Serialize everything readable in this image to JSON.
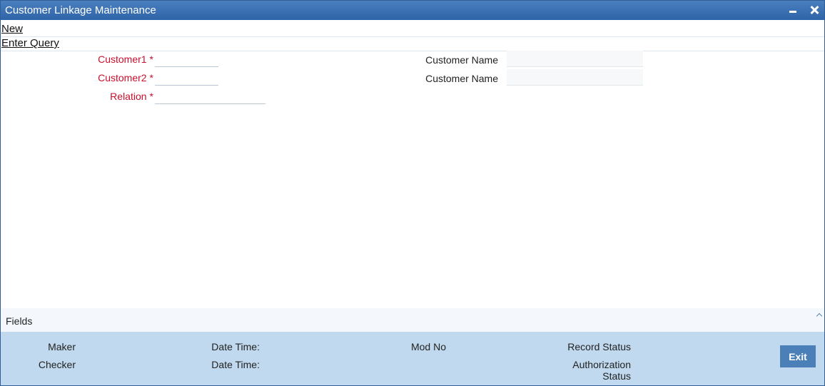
{
  "window": {
    "title": "Customer Linkage Maintenance"
  },
  "menu": {
    "new": "New",
    "enter_query": "Enter Query"
  },
  "form": {
    "customer1": {
      "label": "Customer1",
      "required_mark": "*",
      "value": ""
    },
    "customer2": {
      "label": "Customer2",
      "required_mark": "*",
      "value": ""
    },
    "relation": {
      "label": "Relation",
      "required_mark": "*",
      "value": ""
    },
    "customer1_name": {
      "label": "Customer Name",
      "value": ""
    },
    "customer2_name": {
      "label": "Customer Name",
      "value": ""
    }
  },
  "fields_section": {
    "label": "Fields"
  },
  "footer": {
    "maker": "Maker",
    "checker": "Checker",
    "date_time_1": "Date Time:",
    "date_time_2": "Date Time:",
    "mod_no": "Mod No",
    "record_status": "Record Status",
    "authorization_status_line1": "Authorization",
    "authorization_status_line2": "Status",
    "exit": "Exit"
  },
  "colors": {
    "title_bar": "#3a6fb2",
    "required_label": "#c8102e",
    "footer_bg": "#c0d9ee",
    "exit_button": "#4a7fb7"
  }
}
